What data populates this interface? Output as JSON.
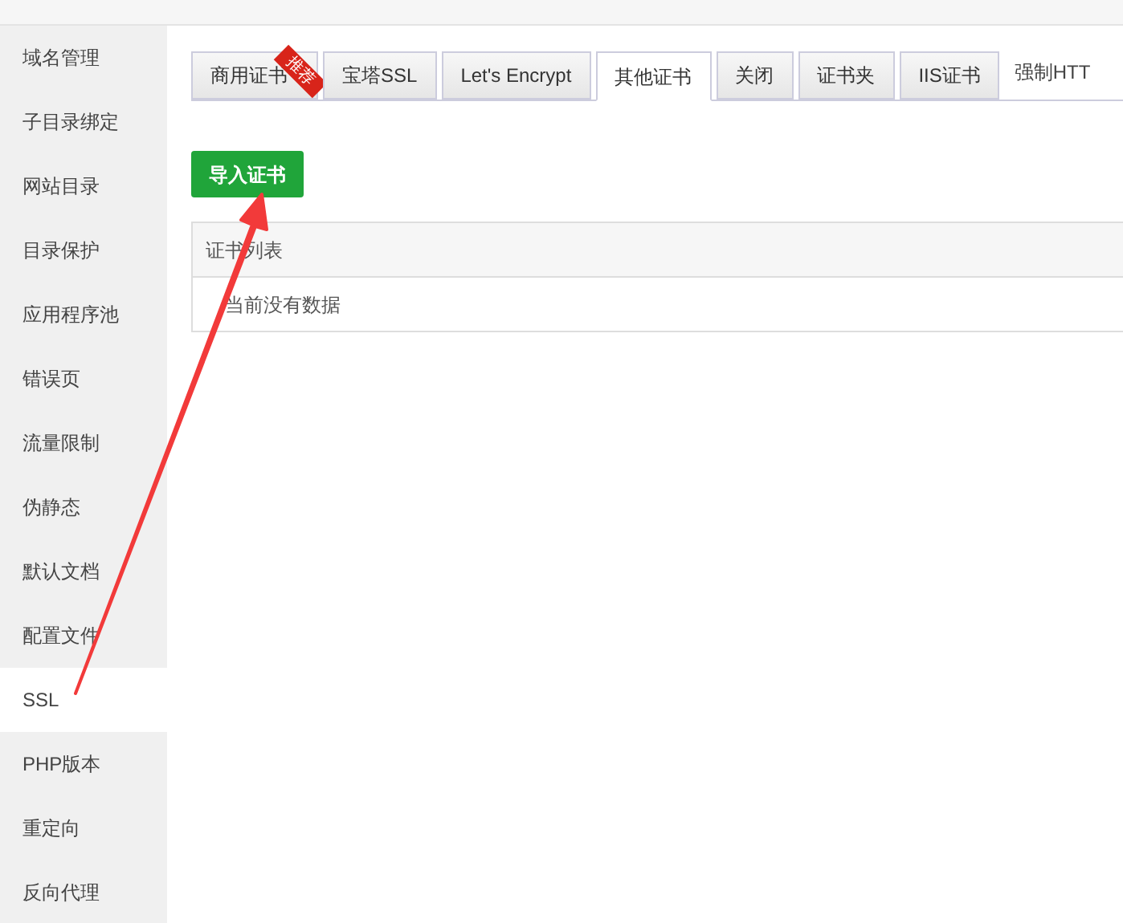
{
  "sidebar": {
    "items": [
      {
        "label": "域名管理",
        "selected": false
      },
      {
        "label": "子目录绑定",
        "selected": false
      },
      {
        "label": "网站目录",
        "selected": false
      },
      {
        "label": "目录保护",
        "selected": false
      },
      {
        "label": "应用程序池",
        "selected": false
      },
      {
        "label": "错误页",
        "selected": false
      },
      {
        "label": "流量限制",
        "selected": false
      },
      {
        "label": "伪静态",
        "selected": false
      },
      {
        "label": "默认文档",
        "selected": false
      },
      {
        "label": "配置文件",
        "selected": false
      },
      {
        "label": "SSL",
        "selected": true
      },
      {
        "label": "PHP版本",
        "selected": false
      },
      {
        "label": "重定向",
        "selected": false
      },
      {
        "label": "反向代理",
        "selected": false
      }
    ]
  },
  "tabs": [
    {
      "label": "商用证书",
      "selected": false,
      "ribbon": "推荐"
    },
    {
      "label": "宝塔SSL",
      "selected": false
    },
    {
      "label": "Let's Encrypt",
      "selected": false
    },
    {
      "label": "其他证书",
      "selected": true
    },
    {
      "label": "关闭",
      "selected": false
    },
    {
      "label": "证书夹",
      "selected": false
    },
    {
      "label": "IIS证书",
      "selected": false
    },
    {
      "label": "强制HTT",
      "selected": false,
      "kind": "plain"
    }
  ],
  "import_button": "导入证书",
  "table": {
    "columns": [
      "证书列表"
    ],
    "empty_text": "当前没有数据"
  }
}
